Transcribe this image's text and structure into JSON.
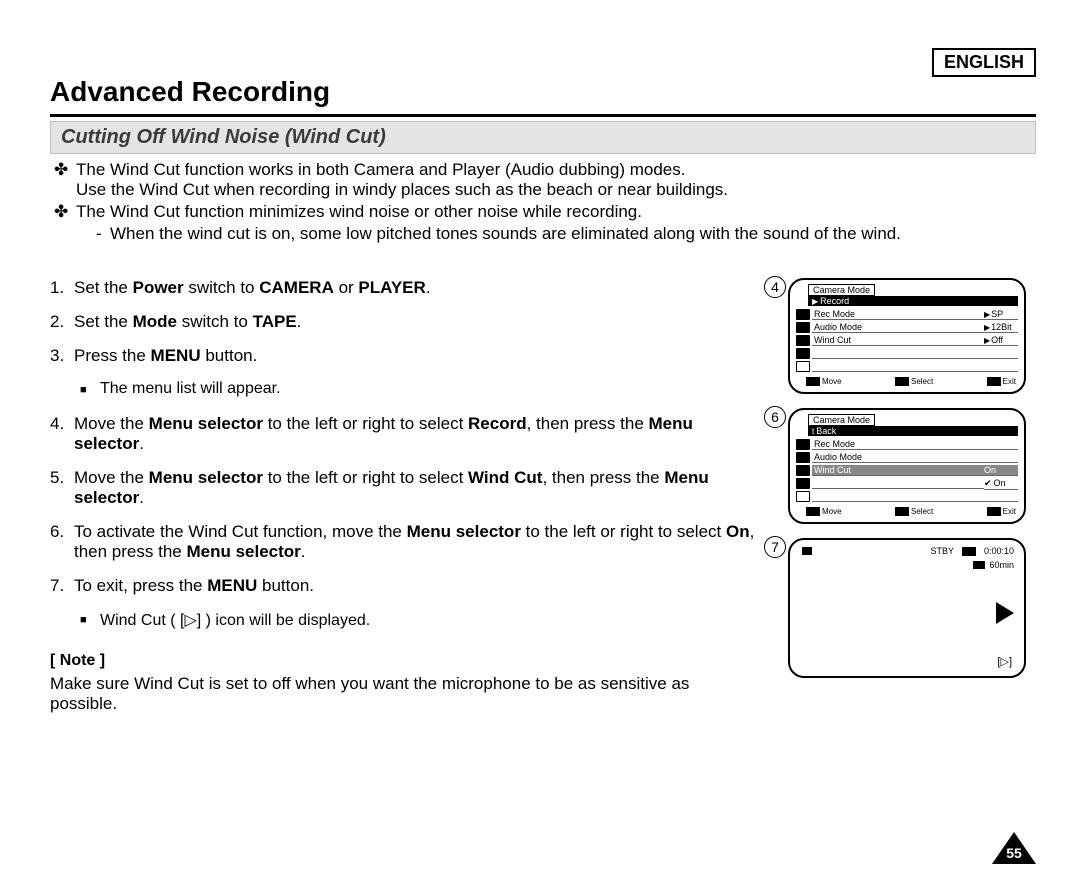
{
  "language_label": "ENGLISH",
  "title": "Advanced Recording",
  "subhead": "Cutting Off Wind Noise (Wind Cut)",
  "intro": {
    "p1a": "The Wind Cut function works in both Camera and Player (Audio dubbing) modes.",
    "p1b": "Use the Wind Cut when recording in windy places such as the beach or near buildings.",
    "p2": "The Wind Cut function minimizes wind noise or other noise while recording.",
    "p2s": "When the wind cut is on, some low pitched tones sounds are eliminated along with the sound of the wind."
  },
  "steps": {
    "s1": {
      "num": "1.",
      "pre": "Set the ",
      "b1": "Power",
      "mid1": " switch to ",
      "b2": "CAMERA",
      "mid2": " or ",
      "b3": "PLAYER",
      "post": "."
    },
    "s2": {
      "num": "2.",
      "pre": "Set the ",
      "b1": "Mode",
      "mid1": " switch to ",
      "b2": "TAPE",
      "post": "."
    },
    "s3": {
      "num": "3.",
      "pre": "Press the ",
      "b1": "MENU",
      "post": " button.",
      "sub": "The menu list will appear."
    },
    "s4": {
      "num": "4.",
      "pre": "Move the ",
      "b1": "Menu selector",
      "mid1": " to the left or right to select ",
      "b2": "Record",
      "mid2": ", then press the ",
      "b3": "Menu selector",
      "post": "."
    },
    "s5": {
      "num": "5.",
      "pre": "Move the ",
      "b1": "Menu selector",
      "mid1": " to the left or right to select ",
      "b2": "Wind Cut",
      "mid2": ", then press the ",
      "b3": "Menu selector",
      "post": "."
    },
    "s6": {
      "num": "6.",
      "pre": "To activate the Wind Cut function, move the ",
      "b1": "Menu selector",
      "mid1": " to the left or right to select ",
      "b2": "On",
      "mid2": ", then press the ",
      "b3": "Menu selector",
      "post": "."
    },
    "s7": {
      "num": "7.",
      "pre": "To exit, press the ",
      "b1": "MENU",
      "post": " button.",
      "sub": "Wind Cut ( [▷] ) icon will be displayed."
    }
  },
  "note": {
    "head": "[ Note ]",
    "body": "Make sure Wind Cut is set to off when you want the microphone to be as sensitive as possible."
  },
  "fig4": {
    "circle": "4",
    "title": "Camera Mode",
    "selected": "Record",
    "rows": [
      {
        "label": "Rec Mode",
        "value": "SP"
      },
      {
        "label": "Audio Mode",
        "value": "12Bit"
      },
      {
        "label": "Wind Cut",
        "value": "Off"
      }
    ],
    "foot": {
      "a": "Move",
      "b": "Select",
      "c": "Exit"
    }
  },
  "fig6": {
    "circle": "6",
    "title": "Camera Mode",
    "back": "Back",
    "rows": [
      {
        "label": "Rec Mode"
      },
      {
        "label": "Audio Mode"
      }
    ],
    "hl": {
      "label": "Wind Cut",
      "value": "On"
    },
    "chk": "On",
    "foot": {
      "a": "Move",
      "b": "Select",
      "c": "Exit"
    }
  },
  "fig7": {
    "circle": "7",
    "stby": "STBY",
    "time": "0:00:10",
    "remain": "60min",
    "wc": "[▷]"
  },
  "page_number": "55"
}
